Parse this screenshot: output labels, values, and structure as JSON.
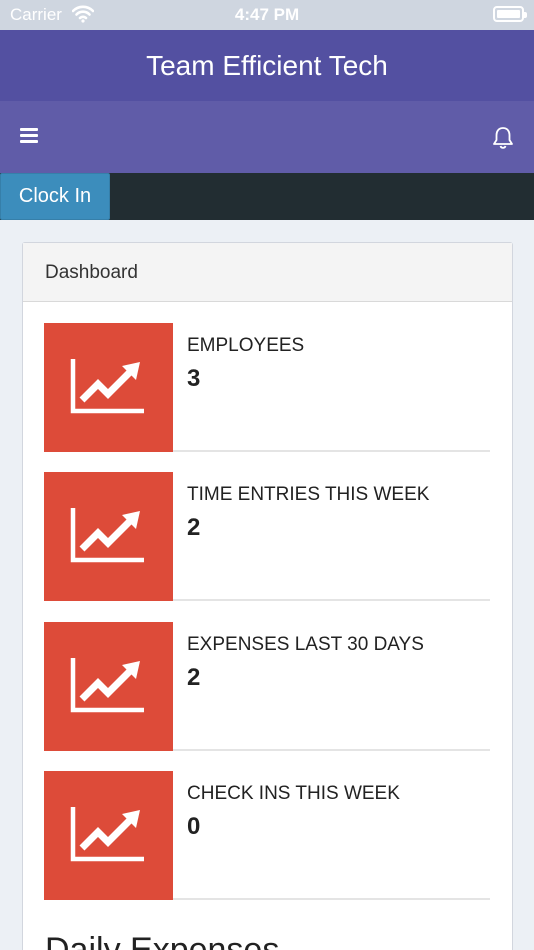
{
  "status_bar": {
    "carrier": "Carrier",
    "time": "4:47 PM"
  },
  "header": {
    "title": "Team Efficient Tech"
  },
  "nav": {
    "menu_icon": "hamburger-menu-icon",
    "notification_icon": "bell-icon"
  },
  "actions": {
    "clock_in_label": "Clock In"
  },
  "dashboard": {
    "title": "Dashboard",
    "stats": [
      {
        "label": "EMPLOYEES",
        "value": "3",
        "icon": "line-chart-icon"
      },
      {
        "label": "TIME ENTRIES THIS WEEK",
        "value": "2",
        "icon": "line-chart-icon"
      },
      {
        "label": "EXPENSES LAST 30 DAYS",
        "value": "2",
        "icon": "line-chart-icon"
      },
      {
        "label": "CHECK INS THIS WEEK",
        "value": "0",
        "icon": "line-chart-icon"
      }
    ],
    "section_title": "Daily Expenses"
  },
  "colors": {
    "title_bar": "#5350a1",
    "nav_bar": "#605ca8",
    "action_bar": "#222d32",
    "button": "#3c8dbc",
    "stat_icon_bg": "#dd4b39",
    "page_bg": "#ecf0f5"
  }
}
